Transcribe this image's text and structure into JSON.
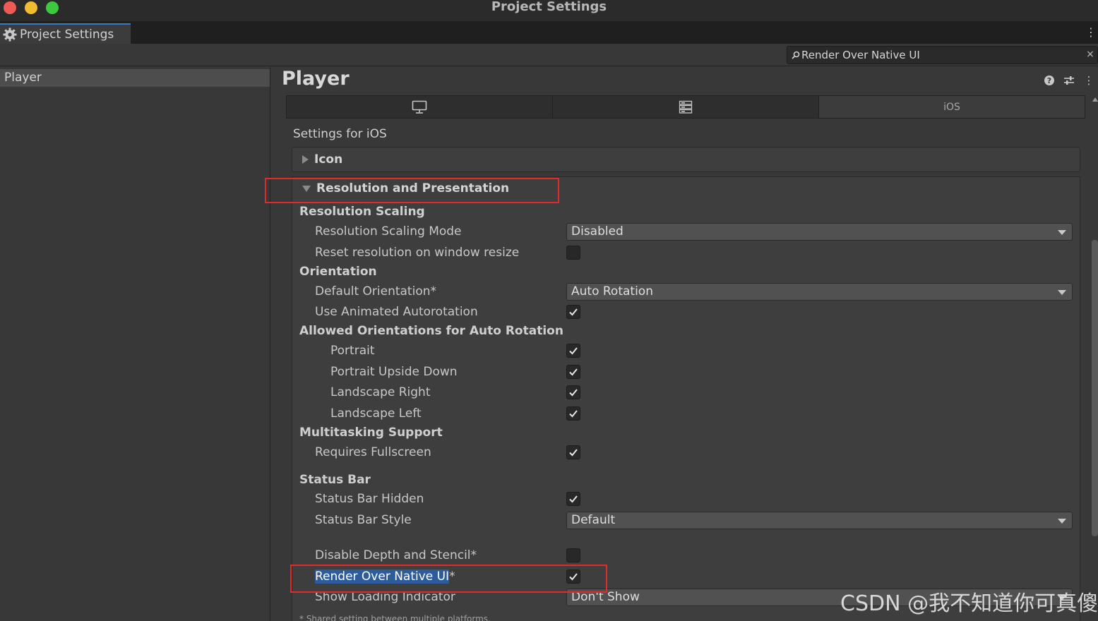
{
  "window": {
    "title": "Project Settings"
  },
  "tab": {
    "label": "Project Settings",
    "icon": "gear-icon"
  },
  "search": {
    "value": "Render Over Native UI",
    "clear_label": "×"
  },
  "sidebar": {
    "items": [
      {
        "label": "Player"
      }
    ]
  },
  "main": {
    "title": "Player",
    "header_icons": [
      "help-icon",
      "presets-icon",
      "more-icon"
    ],
    "platform_tabs": [
      {
        "icon": "monitor-icon",
        "label": ""
      },
      {
        "icon": "server-icon",
        "label": ""
      },
      {
        "icon": "",
        "label": "iOS"
      }
    ],
    "settings_for": "Settings for iOS",
    "foldouts": {
      "icon": "Icon",
      "resolution": "Resolution and Presentation"
    },
    "sections": {
      "resolution_scaling": {
        "title": "Resolution Scaling",
        "mode_label": "Resolution Scaling Mode",
        "mode_value": "Disabled",
        "reset_label": "Reset resolution on window resize",
        "reset_checked": false
      },
      "orientation": {
        "title": "Orientation",
        "default_label": "Default Orientation*",
        "default_value": "Auto Rotation",
        "animated_label": "Use Animated Autorotation",
        "animated_checked": true
      },
      "allowed": {
        "title": "Allowed Orientations for Auto Rotation",
        "portrait": "Portrait",
        "portrait_upside_down": "Portrait Upside Down",
        "landscape_right": "Landscape Right",
        "landscape_left": "Landscape Left"
      },
      "multitasking": {
        "title": "Multitasking Support",
        "fullscreen_label": "Requires Fullscreen",
        "fullscreen_checked": true
      },
      "status_bar": {
        "title": "Status Bar",
        "hidden_label": "Status Bar Hidden",
        "hidden_checked": true,
        "style_label": "Status Bar Style",
        "style_value": "Default"
      },
      "misc": {
        "depth_label": "Disable Depth and Stencil*",
        "depth_checked": false,
        "render_label_highlight": "Render Over Native UI",
        "render_label_suffix": "*",
        "render_checked": true,
        "loading_label": "Show Loading Indicator",
        "loading_value": "Don't Show"
      }
    },
    "footnote": "* Shared setting between multiple platforms."
  },
  "watermark": "CSDN @我不知道你可真傻",
  "colors": {
    "accent": "#3a79bb",
    "highlight": "#e12a2a",
    "selection": "#2d5c9c"
  }
}
